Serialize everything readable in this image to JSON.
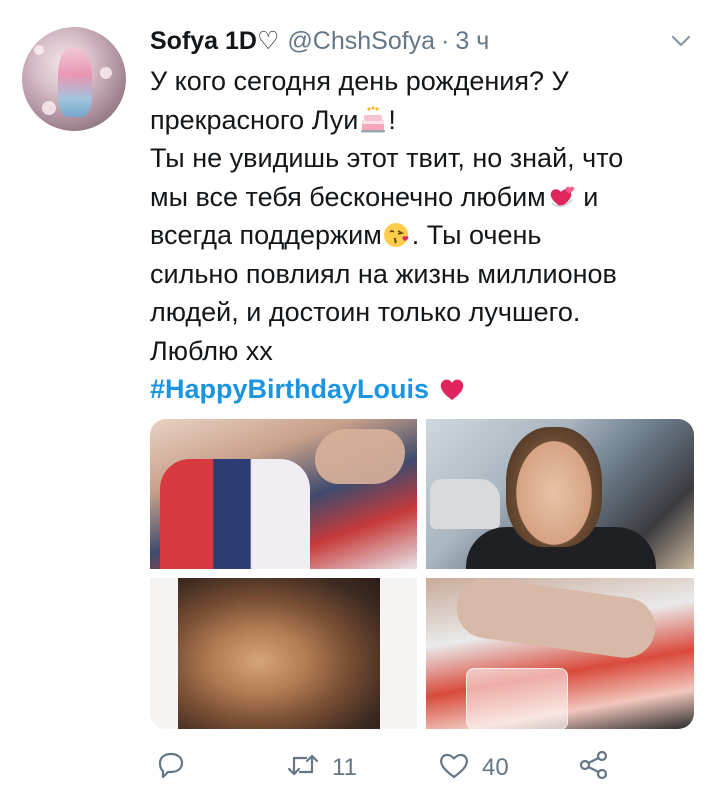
{
  "tweet": {
    "author": {
      "display_name": "Sofya 1D♡",
      "handle": "@ChshSofya",
      "separator": "·",
      "time": "3 ч"
    },
    "text_lines": [
      "У кого сегодня день рождения? У",
      "прекрасного Луи",
      "!",
      "Ты не увидишь этот твит, но знай,  что",
      "мы все тебя бесконечно любим",
      " и",
      "всегда поддержим",
      ". Ты очень",
      "сильно повлиял на жизнь миллионов",
      "людей, и  достоин только лучшего.",
      "Люблю хх"
    ],
    "hashtag": "#HappyBirthdayLouis",
    "emojis": {
      "birthday": "birthday-cake-emoji",
      "hearts": "revolving-hearts-emoji",
      "kiss": "face-blowing-kiss-emoji",
      "red_heart": "red-heart-emoji"
    },
    "media": [
      {
        "name": "photo-jacket"
      },
      {
        "name": "photo-smiling-man"
      },
      {
        "name": "photo-portrait"
      },
      {
        "name": "photo-hands"
      }
    ],
    "actions": {
      "reply": {
        "icon": "reply-icon",
        "count": ""
      },
      "retweet": {
        "icon": "retweet-icon",
        "count": "11"
      },
      "like": {
        "icon": "heart-icon",
        "count": "40"
      },
      "share": {
        "icon": "share-icon",
        "count": ""
      }
    }
  },
  "colors": {
    "text": "#14171a",
    "muted": "#657786",
    "link": "#1b95e0",
    "heart": "#e0245e"
  }
}
